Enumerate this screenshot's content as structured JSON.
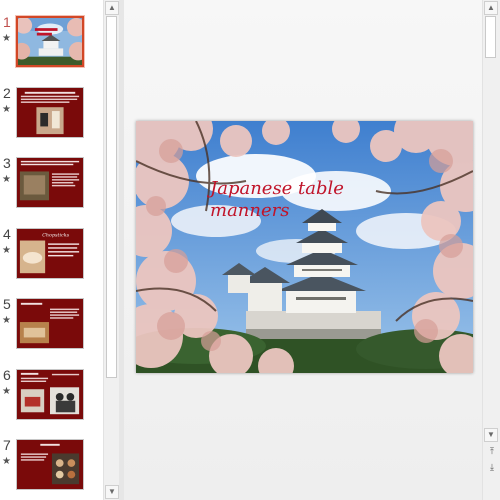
{
  "slides": [
    {
      "number": "1",
      "star": "★",
      "active": true
    },
    {
      "number": "2",
      "star": "★",
      "active": false
    },
    {
      "number": "3",
      "star": "★",
      "active": false
    },
    {
      "number": "4",
      "star": "★",
      "active": false
    },
    {
      "number": "5",
      "star": "★",
      "active": false
    },
    {
      "number": "6",
      "star": "★",
      "active": false
    },
    {
      "number": "7",
      "star": "★",
      "active": false
    }
  ],
  "thumb_labels": {
    "slide4_title": "Chopsticks"
  },
  "current_slide": {
    "title": "Japanese table\nmanners"
  },
  "scrollbars": {
    "up_arrow": "▲",
    "down_arrow": "▼",
    "prev_slide": "⤒",
    "next_slide": "⤓"
  },
  "colors": {
    "slide_background": "#7a0a0a",
    "title_color": "#c0142a",
    "active_thumb_border": "#d24726"
  }
}
